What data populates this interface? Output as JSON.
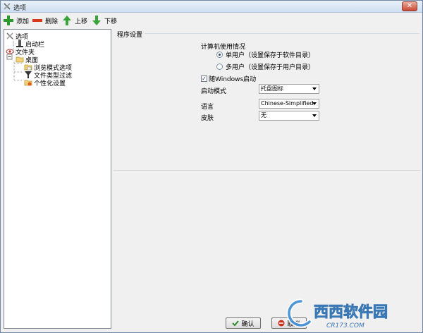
{
  "window": {
    "title": "选项"
  },
  "toolbar": {
    "add_label": "添加",
    "delete_label": "删除",
    "up_label": "上移",
    "down_label": "下移"
  },
  "tree": {
    "items": [
      {
        "label": "选项",
        "icon": "options-tools-icon"
      },
      {
        "label": "启动栏",
        "icon": "launcher-icon"
      },
      {
        "label": "文件夹",
        "icon": "folder-eye-icon"
      },
      {
        "label": "桌面",
        "icon": "desktop-folder-icon"
      },
      {
        "label": "浏览模式选项",
        "icon": "browse-mode-icon"
      },
      {
        "label": "文件类型过滤",
        "icon": "filter-icon"
      },
      {
        "label": "个性化设置",
        "icon": "personalize-icon"
      }
    ]
  },
  "settings": {
    "section_title": "程序设置",
    "usage_group": "计算机使用情况",
    "radio_single": "单用户（设置保存于软件目录）",
    "radio_multi": "多用户（设置保存于用户目录）",
    "radio_selected": "single",
    "startup_checkbox": "随Windows启动",
    "startup_checked": true,
    "launch_mode_label": "启动模式",
    "launch_mode_value": "托盘图标",
    "language_label": "语言",
    "language_value": "Chinese-Simplified",
    "skin_label": "皮肤",
    "skin_value": "无"
  },
  "buttons": {
    "ok_label": "确认",
    "cancel_label": "取消"
  },
  "watermark": {
    "brand": "西西软件园",
    "url": "CR173.COM"
  }
}
